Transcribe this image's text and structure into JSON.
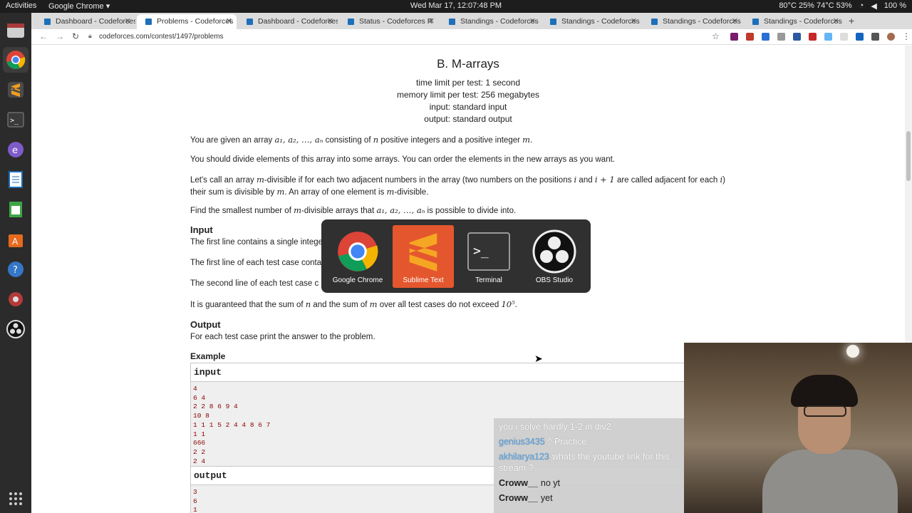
{
  "system_bar": {
    "activities": "Activities",
    "app_menu": "Google Chrome ▾",
    "clock": "Wed Mar 17, 12:07:48 PM",
    "status": "80°C 25% 74°C 53%",
    "battery": "100 %"
  },
  "dock": {
    "items": [
      "files-icon",
      "chrome-icon",
      "sublime-icon",
      "terminal-icon",
      "emacs-icon",
      "writer-icon",
      "calc-icon",
      "software-icon",
      "help-icon",
      "settings-icon",
      "obs-icon",
      "app-grid-icon"
    ]
  },
  "browser": {
    "tabs": [
      {
        "label": "Dashboard - Codeforces",
        "active": false
      },
      {
        "label": "Problems - Codeforces",
        "active": true
      },
      {
        "label": "Dashboard - Codeforces",
        "active": false
      },
      {
        "label": "Status - Codeforces R",
        "active": false
      },
      {
        "label": "Standings - Codeforces",
        "active": false
      },
      {
        "label": "Standings - Codeforces",
        "active": false
      },
      {
        "label": "Standings - Codeforces",
        "active": false
      },
      {
        "label": "Standings - Codeforces",
        "active": false
      }
    ],
    "url": "codeforces.com/contest/1497/problems"
  },
  "problem": {
    "title": "B. M-arrays",
    "time_limit": "time limit per test: 1 second",
    "memory_limit": "memory limit per test: 256 megabytes",
    "input_spec": "input: standard input",
    "output_spec": "output: standard output",
    "p1_a": "You are given an array ",
    "p1_math1": "a₁, a₂, …, aₙ",
    "p1_b": " consisting of ",
    "p1_math2": "n",
    "p1_c": " positive integers and a positive integer ",
    "p1_math3": "m",
    "p1_d": ".",
    "p2": "You should divide elements of this array into some arrays. You can order the elements in the new arrays as you want.",
    "p3_a": "Let's call an array ",
    "p3_math1": "m",
    "p3_b": "-divisible if for each two adjacent numbers in the array (two numbers on the positions ",
    "p3_math2": "i",
    "p3_c": " and ",
    "p3_math3": "i + 1",
    "p3_d": " are called adjacent for each ",
    "p3_math4": "i",
    "p3_e": ")",
    "p3_f": "their sum is divisible by ",
    "p3_math5": "m",
    "p3_g": ". An array of one element is ",
    "p3_math6": "m",
    "p3_h": "-divisible.",
    "p4_a": "Find the smallest number of ",
    "p4_math1": "m",
    "p4_b": "-divisible arrays that ",
    "p4_math2": "a₁, a₂, …, aₙ",
    "p4_c": " is possible to divide into.",
    "input_heading": "Input",
    "in1": "The first line contains a single intege",
    "in2": "The first line of each test case conta",
    "in3": "The second line of each test case c",
    "in4_a": "It is guaranteed that the sum of ",
    "in4_math1": "n",
    "in4_b": " and the sum of ",
    "in4_math2": "m",
    "in4_c": " over all test cases do not exceed ",
    "in4_math3": "10⁵",
    "in4_d": ".",
    "output_heading": "Output",
    "out1": "For each test case print the answer to the problem.",
    "example_heading": "Example",
    "sample_input_label": "input",
    "sample_input_lines": [
      "4",
      "6 4",
      "2 2 8 6 9 4",
      "10 8",
      "1 1 1 5 2 4 4 8 6 7",
      "1 1",
      "666",
      "2 2",
      "2 4"
    ],
    "sample_output_label": "output",
    "sample_output_lines": [
      "3",
      "6",
      "1"
    ]
  },
  "switcher": {
    "apps": [
      {
        "label": "Google Chrome",
        "icon": "chrome-icon"
      },
      {
        "label": "Sublime Text",
        "icon": "sublime-icon"
      },
      {
        "label": "Terminal",
        "icon": "terminal-icon"
      },
      {
        "label": "OBS Studio",
        "icon": "obs-icon"
      }
    ]
  },
  "chat": {
    "lines": [
      {
        "user": "",
        "message": "you i solve hardly 1-2 in div2"
      },
      {
        "user": "genius3435",
        "message": "^ Practice."
      },
      {
        "user": "akhilarya123",
        "message": "whats the youtube link for this stream ?"
      },
      {
        "user": "Croww__",
        "message": "no yt"
      },
      {
        "user": "Croww__",
        "message": "yet"
      }
    ]
  }
}
